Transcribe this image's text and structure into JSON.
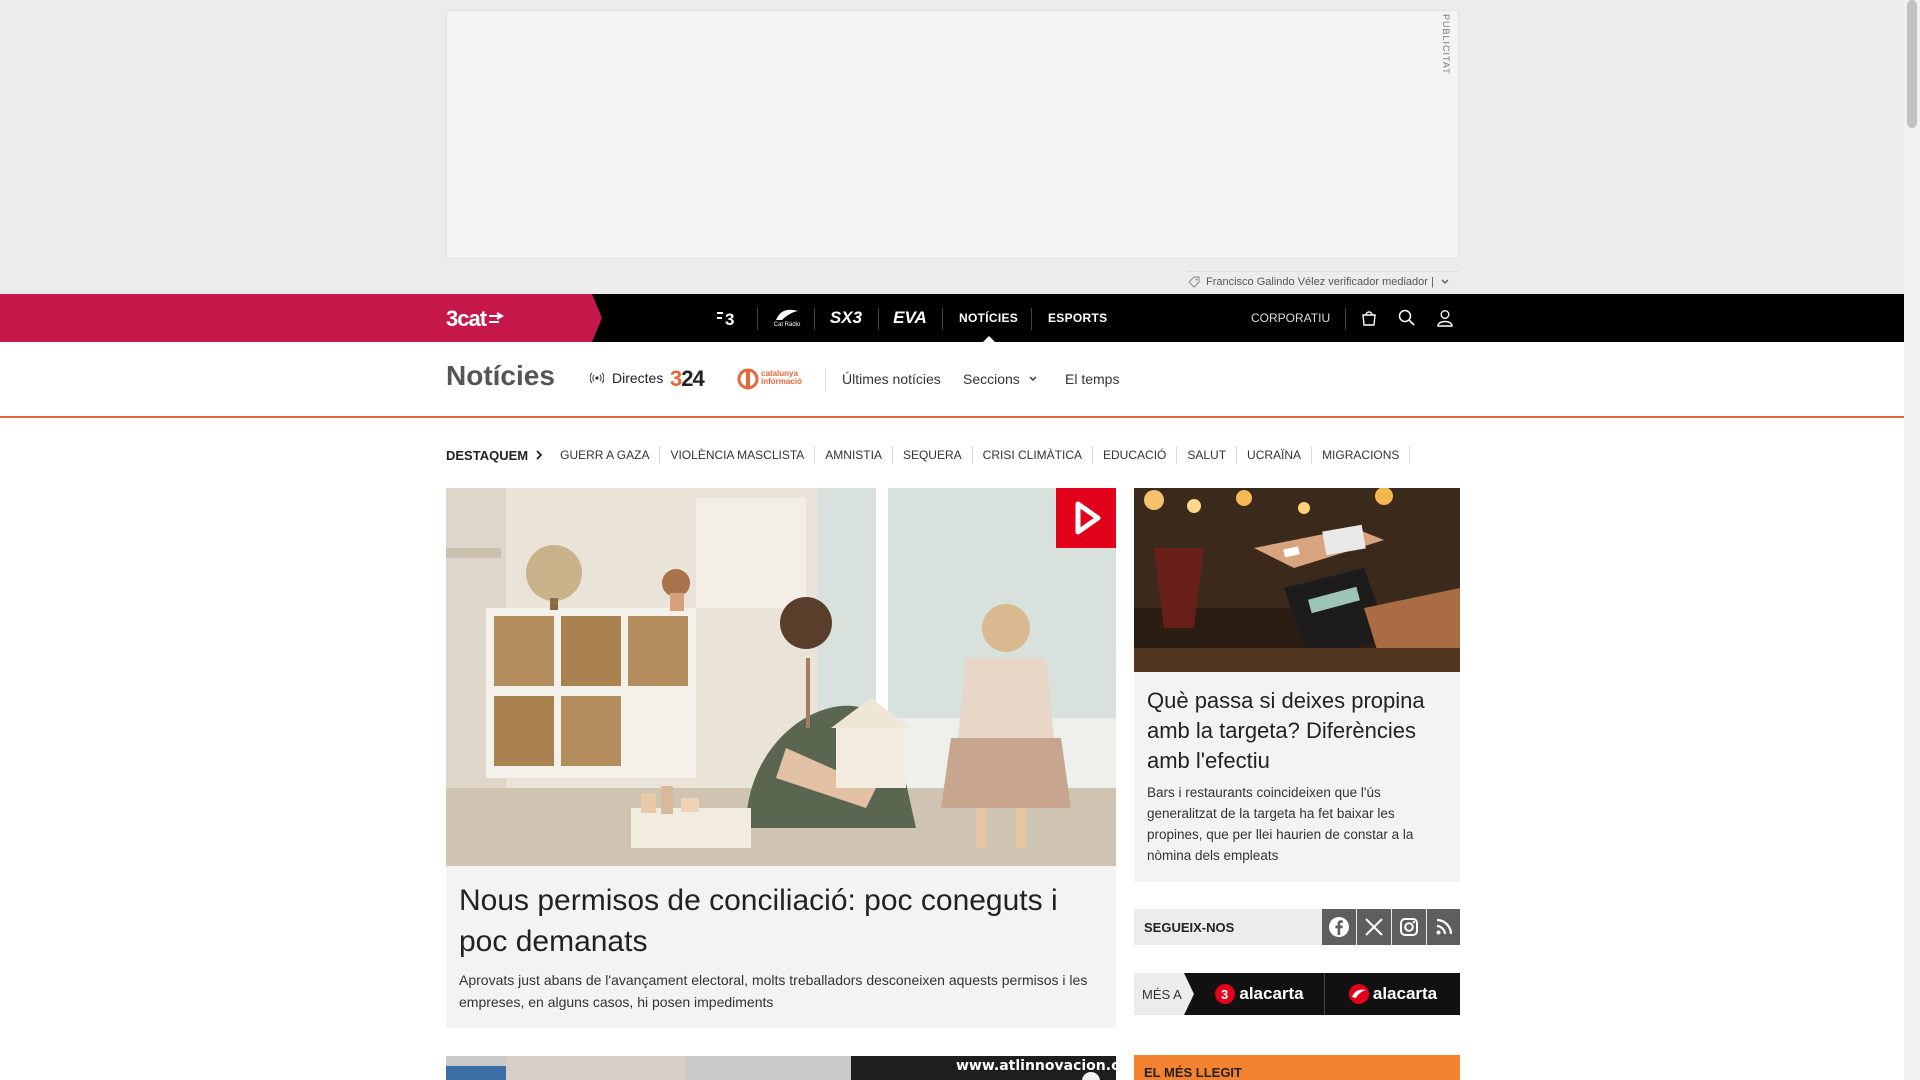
{
  "ad": {
    "label": "PUBLICITAT",
    "sponsor_text": "Francisco Galindo Vélez verificador mediador |"
  },
  "topnav": {
    "brand": "3cat",
    "channels": [
      "3",
      "Cat Ràdio",
      "SX3",
      "EVA"
    ],
    "items": [
      {
        "label": "NOTÍCIES",
        "active": true
      },
      {
        "label": "ESPORTS",
        "active": false
      }
    ],
    "corporate": "CORPORATIU"
  },
  "section": {
    "title": "Notícies",
    "directes": "Directes",
    "logo_324": "324",
    "logo_catinfo": "catalunya informació",
    "links": [
      "Últimes notícies",
      "Seccions",
      "El temps"
    ]
  },
  "destaquem": {
    "title": "DESTAQUEM",
    "items": [
      "GUERR A GAZA",
      "VIOLÈNCIA MASCLISTA",
      "AMNISTIA",
      "SEQUERA",
      "CRISI CLIMÀTICA",
      "EDUCACIÓ",
      "SALUT",
      "UCRAÏNA",
      "MIGRACIONS"
    ]
  },
  "main_article": {
    "title": "Nous permisos de conciliació: poc coneguts i poc demanats",
    "summary": "Aprovats just abans de l'avançament electoral, molts treballadors desconeixen aquests permisos i les empreses, en alguns casos, hi posen impediments"
  },
  "second_article": {
    "watermark": "www.atlinnovacion.com"
  },
  "side_article": {
    "title": "Què passa si deixes propina amb la targeta? Diferències amb l'efectiu",
    "summary": "Bars i restaurants coincideixen que l'ús generalitzat de la targeta ha fet baixar les propines, que per llei haurien de constar a la nòmina dels empleats"
  },
  "follow": {
    "label": "SEGUEIX-NOS",
    "icons": [
      "facebook-icon",
      "x-icon",
      "instagram-icon",
      "rss-icon"
    ]
  },
  "mesa": {
    "label": "MÉS A",
    "brands": [
      "alacarta",
      "alacarta"
    ]
  },
  "mes_llegit": {
    "label": "EL MÉS LLEGIT"
  },
  "colors": {
    "brand_pink": "#c5174a",
    "accent_orange": "#e8663a",
    "play_red": "#e3001b"
  }
}
